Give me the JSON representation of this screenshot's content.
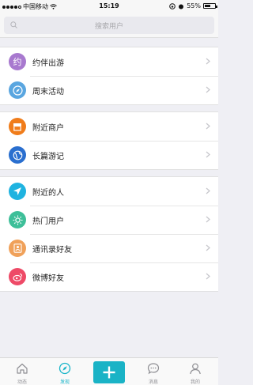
{
  "status": {
    "carrier": "中国移动",
    "time": "15:19",
    "battery": "55%",
    "battery_level": 0.55
  },
  "search": {
    "placeholder": "搜索用户"
  },
  "groups": [
    {
      "items": [
        {
          "label": "约伴出游",
          "icon": "yue-icon",
          "glyph": "约",
          "color": "#a879cf"
        },
        {
          "label": "周末活动",
          "icon": "compass-icon",
          "color": "#5aa6e0"
        }
      ]
    },
    {
      "items": [
        {
          "label": "附近商户",
          "icon": "shop-icon",
          "color": "#f07c1a"
        },
        {
          "label": "长篇游记",
          "icon": "globe-icon",
          "color": "#2a6fcf"
        }
      ]
    },
    {
      "items": [
        {
          "label": "附近的人",
          "icon": "location-arrow-icon",
          "color": "#1fb3e0"
        },
        {
          "label": "热门用户",
          "icon": "sun-icon",
          "color": "#3ebf99"
        },
        {
          "label": "通讯录好友",
          "icon": "contacts-icon",
          "color": "#f0a15a"
        },
        {
          "label": "微博好友",
          "icon": "weibo-icon",
          "color": "#ee4a67"
        }
      ]
    }
  ],
  "tabs": [
    {
      "label": "动态",
      "icon": "home-icon",
      "active": false
    },
    {
      "label": "发现",
      "icon": "compass-icon",
      "active": true
    },
    {
      "label": "",
      "icon": "plus-icon",
      "active": false
    },
    {
      "label": "消息",
      "icon": "chat-icon",
      "active": false
    },
    {
      "label": "我的",
      "icon": "user-icon",
      "active": false
    }
  ],
  "colors": {
    "accent": "#1ab3c6",
    "background": "#efeff4"
  }
}
